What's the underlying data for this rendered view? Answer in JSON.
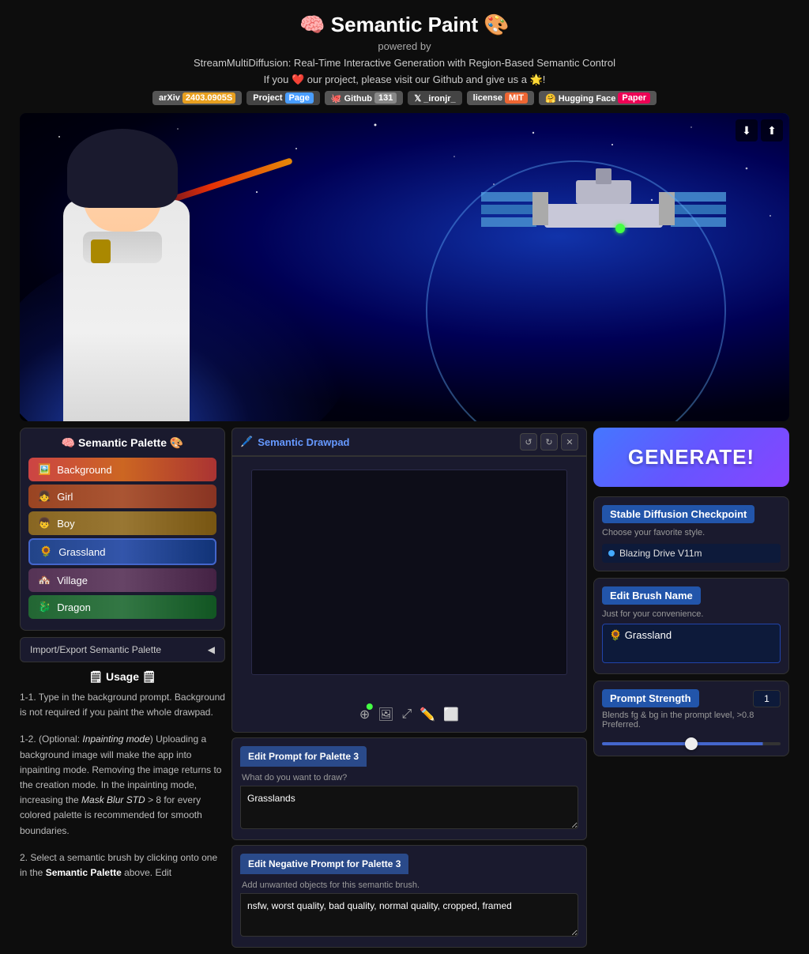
{
  "header": {
    "title": "🧠 Semantic Paint 🎨",
    "powered_by": "powered by",
    "subtitle": "StreamMultiDiffusion: Real-Time Interactive Generation with Region-Based Semantic Control",
    "love_text": "If you ❤️ our project, please visit our Github and give us a 🌟!",
    "badges": [
      {
        "label": "arXiv",
        "extra": "2403.0905S",
        "type": "arxiv"
      },
      {
        "label": "Project",
        "extra": "Page",
        "type": "project"
      },
      {
        "label": "Github",
        "extra": "131",
        "type": "github"
      },
      {
        "label": "𝕏 _ironjr_",
        "type": "x"
      },
      {
        "label": "license",
        "extra": "MIT",
        "type": "license"
      },
      {
        "label": "🤗 Hugging Face",
        "extra": "Paper",
        "type": "hugging"
      }
    ]
  },
  "palette": {
    "title": "🧠 Semantic Palette 🎨",
    "items": [
      {
        "emoji": "🖼️",
        "label": "Background",
        "type": "bg"
      },
      {
        "emoji": "👧",
        "label": "Girl",
        "type": "girl"
      },
      {
        "emoji": "👦",
        "label": "Boy",
        "type": "boy"
      },
      {
        "emoji": "🌻",
        "label": "Grassland",
        "type": "grassland",
        "active": true
      },
      {
        "emoji": "🏘️",
        "label": "Village",
        "type": "village"
      },
      {
        "emoji": "🐉",
        "label": "Dragon",
        "type": "dragon"
      }
    ],
    "import_export_label": "Import/Export Semantic Palette"
  },
  "usage": {
    "title": "🗒 Usage 🗒",
    "paragraphs": [
      "1-1. Type in the background prompt. Background is not required if you paint the whole drawpad.",
      "1-2. (Optional: Inpainting mode) Uploading a background image will make the app into inpainting mode. Removing the image returns to the creation mode. In the inpainting mode, increasing the Mask Blur STD > 8 for every colored palette is recommended for smooth boundaries.",
      "2. Select a semantic brush by clicking onto one in the Semantic Palette above. Edit"
    ]
  },
  "drawpad": {
    "title": "Semantic Drawpad",
    "icon": "🖊️",
    "controls": [
      "↺",
      "↻",
      "✕"
    ]
  },
  "toolbar": {
    "cursor_icon": "⊕",
    "upload_icon": "🖼",
    "crop_icon": "⤢",
    "brush_icon": "✏️",
    "eraser_icon": "⬜"
  },
  "prompts": {
    "edit_prompt_header": "Edit Prompt for Palette 3",
    "edit_prompt_placeholder": "What do you want to draw?",
    "edit_prompt_value": "Grasslands",
    "edit_neg_header": "Edit Negative Prompt for Palette 3",
    "edit_neg_placeholder": "Add unwanted objects for this semantic brush.",
    "edit_neg_value": "nsfw, worst quality, bad quality, normal quality, cropped, framed"
  },
  "right_panel": {
    "generate_label": "GENERATE!",
    "sd_title": "Stable Diffusion Checkpoint",
    "sd_sub": "Choose your favorite style.",
    "sd_option": "Blazing Drive V11m",
    "brush_title": "Edit Brush Name",
    "brush_sub": "Just for your convenience.",
    "brush_value": "🌻 Grassland",
    "ps_title": "Prompt Strength",
    "ps_value": "1",
    "ps_sub": "Blends fg & bg in the prompt level, >0.8 Preferred.",
    "ps_slider_pct": 90
  }
}
